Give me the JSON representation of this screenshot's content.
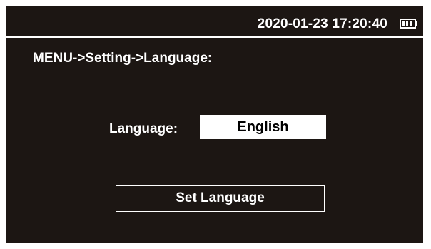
{
  "status_bar": {
    "datetime": "2020-01-23 17:20:40",
    "battery_icon": "battery-icon",
    "battery_level": 0.75
  },
  "menu": {
    "breadcrumb": "MENU->Setting->Language:"
  },
  "language": {
    "label": "Language:",
    "value": "English"
  },
  "actions": {
    "set_language_label": "Set Language"
  },
  "colors": {
    "background": "#1c1613",
    "foreground": "#ffffff",
    "value_background": "#ffffff",
    "value_text": "#000000"
  }
}
